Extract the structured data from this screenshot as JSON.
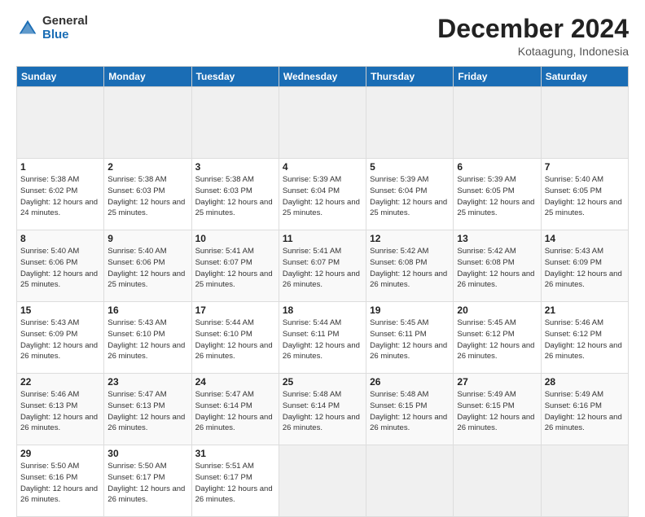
{
  "logo": {
    "general": "General",
    "blue": "Blue"
  },
  "header": {
    "title": "December 2024",
    "subtitle": "Kotaagung, Indonesia"
  },
  "calendar": {
    "days_of_week": [
      "Sunday",
      "Monday",
      "Tuesday",
      "Wednesday",
      "Thursday",
      "Friday",
      "Saturday"
    ],
    "weeks": [
      [
        {
          "day": "",
          "empty": true
        },
        {
          "day": "",
          "empty": true
        },
        {
          "day": "",
          "empty": true
        },
        {
          "day": "",
          "empty": true
        },
        {
          "day": "",
          "empty": true
        },
        {
          "day": "",
          "empty": true
        },
        {
          "day": "",
          "empty": true
        }
      ],
      [
        {
          "day": "1",
          "sunrise": "5:38 AM",
          "sunset": "6:02 PM",
          "daylight": "12 hours and 24 minutes."
        },
        {
          "day": "2",
          "sunrise": "5:38 AM",
          "sunset": "6:03 PM",
          "daylight": "12 hours and 25 minutes."
        },
        {
          "day": "3",
          "sunrise": "5:38 AM",
          "sunset": "6:03 PM",
          "daylight": "12 hours and 25 minutes."
        },
        {
          "day": "4",
          "sunrise": "5:39 AM",
          "sunset": "6:04 PM",
          "daylight": "12 hours and 25 minutes."
        },
        {
          "day": "5",
          "sunrise": "5:39 AM",
          "sunset": "6:04 PM",
          "daylight": "12 hours and 25 minutes."
        },
        {
          "day": "6",
          "sunrise": "5:39 AM",
          "sunset": "6:05 PM",
          "daylight": "12 hours and 25 minutes."
        },
        {
          "day": "7",
          "sunrise": "5:40 AM",
          "sunset": "6:05 PM",
          "daylight": "12 hours and 25 minutes."
        }
      ],
      [
        {
          "day": "8",
          "sunrise": "5:40 AM",
          "sunset": "6:06 PM",
          "daylight": "12 hours and 25 minutes."
        },
        {
          "day": "9",
          "sunrise": "5:40 AM",
          "sunset": "6:06 PM",
          "daylight": "12 hours and 25 minutes."
        },
        {
          "day": "10",
          "sunrise": "5:41 AM",
          "sunset": "6:07 PM",
          "daylight": "12 hours and 25 minutes."
        },
        {
          "day": "11",
          "sunrise": "5:41 AM",
          "sunset": "6:07 PM",
          "daylight": "12 hours and 26 minutes."
        },
        {
          "day": "12",
          "sunrise": "5:42 AM",
          "sunset": "6:08 PM",
          "daylight": "12 hours and 26 minutes."
        },
        {
          "day": "13",
          "sunrise": "5:42 AM",
          "sunset": "6:08 PM",
          "daylight": "12 hours and 26 minutes."
        },
        {
          "day": "14",
          "sunrise": "5:43 AM",
          "sunset": "6:09 PM",
          "daylight": "12 hours and 26 minutes."
        }
      ],
      [
        {
          "day": "15",
          "sunrise": "5:43 AM",
          "sunset": "6:09 PM",
          "daylight": "12 hours and 26 minutes."
        },
        {
          "day": "16",
          "sunrise": "5:43 AM",
          "sunset": "6:10 PM",
          "daylight": "12 hours and 26 minutes."
        },
        {
          "day": "17",
          "sunrise": "5:44 AM",
          "sunset": "6:10 PM",
          "daylight": "12 hours and 26 minutes."
        },
        {
          "day": "18",
          "sunrise": "5:44 AM",
          "sunset": "6:11 PM",
          "daylight": "12 hours and 26 minutes."
        },
        {
          "day": "19",
          "sunrise": "5:45 AM",
          "sunset": "6:11 PM",
          "daylight": "12 hours and 26 minutes."
        },
        {
          "day": "20",
          "sunrise": "5:45 AM",
          "sunset": "6:12 PM",
          "daylight": "12 hours and 26 minutes."
        },
        {
          "day": "21",
          "sunrise": "5:46 AM",
          "sunset": "6:12 PM",
          "daylight": "12 hours and 26 minutes."
        }
      ],
      [
        {
          "day": "22",
          "sunrise": "5:46 AM",
          "sunset": "6:13 PM",
          "daylight": "12 hours and 26 minutes."
        },
        {
          "day": "23",
          "sunrise": "5:47 AM",
          "sunset": "6:13 PM",
          "daylight": "12 hours and 26 minutes."
        },
        {
          "day": "24",
          "sunrise": "5:47 AM",
          "sunset": "6:14 PM",
          "daylight": "12 hours and 26 minutes."
        },
        {
          "day": "25",
          "sunrise": "5:48 AM",
          "sunset": "6:14 PM",
          "daylight": "12 hours and 26 minutes."
        },
        {
          "day": "26",
          "sunrise": "5:48 AM",
          "sunset": "6:15 PM",
          "daylight": "12 hours and 26 minutes."
        },
        {
          "day": "27",
          "sunrise": "5:49 AM",
          "sunset": "6:15 PM",
          "daylight": "12 hours and 26 minutes."
        },
        {
          "day": "28",
          "sunrise": "5:49 AM",
          "sunset": "6:16 PM",
          "daylight": "12 hours and 26 minutes."
        }
      ],
      [
        {
          "day": "29",
          "sunrise": "5:50 AM",
          "sunset": "6:16 PM",
          "daylight": "12 hours and 26 minutes."
        },
        {
          "day": "30",
          "sunrise": "5:50 AM",
          "sunset": "6:17 PM",
          "daylight": "12 hours and 26 minutes."
        },
        {
          "day": "31",
          "sunrise": "5:51 AM",
          "sunset": "6:17 PM",
          "daylight": "12 hours and 26 minutes."
        },
        {
          "day": "",
          "empty": true
        },
        {
          "day": "",
          "empty": true
        },
        {
          "day": "",
          "empty": true
        },
        {
          "day": "",
          "empty": true
        }
      ]
    ],
    "labels": {
      "sunrise": "Sunrise:",
      "sunset": "Sunset:",
      "daylight": "Daylight:"
    }
  }
}
